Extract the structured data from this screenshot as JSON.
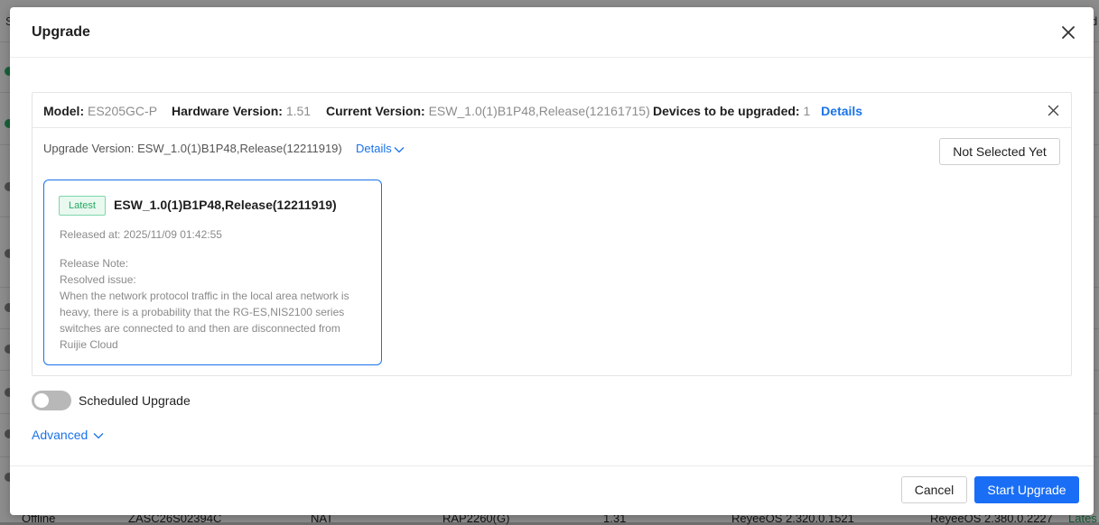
{
  "modal": {
    "title": "Upgrade"
  },
  "info_bar": {
    "model_label": "Model:",
    "model_value": "ES205GC-P",
    "hardware_label": "Hardware Version:",
    "hardware_value": "1.51",
    "current_label": "Current Version:",
    "current_value": "ESW_1.0(1)B1P48,Release(12161715)",
    "devices_label": "Devices to be upgraded:",
    "devices_value": "1",
    "details_link": "Details"
  },
  "upgrade": {
    "version_text": "Upgrade Version: ESW_1.0(1)B1P48,Release(12211919)",
    "details_toggle": "Details",
    "not_selected_button": "Not Selected Yet"
  },
  "version_card": {
    "badge": "Latest",
    "name": "ESW_1.0(1)B1P48,Release(12211919)",
    "released_at": "Released at: 2025/11/09 01:42:55",
    "note_lines": [
      "Release Note:",
      "Resolved issue:",
      "When the network protocol traffic in the local area network is",
      "heavy, there is a probability that the RG-ES,NIS2100 series",
      "switches are connected to and then are disconnected from",
      "Ruijie Cloud"
    ]
  },
  "scheduled": {
    "label": "Scheduled Upgrade",
    "enabled": false
  },
  "advanced": {
    "label": "Advanced"
  },
  "footer": {
    "cancel": "Cancel",
    "start": "Start Upgrade"
  },
  "background": {
    "bottom_row": [
      "Offline",
      "ZASC26S02394C",
      "NAT",
      "RAP2260(G)",
      "1.31",
      "ReyeeOS 2.320.0.1521",
      "ReyeeOS 2.380.0.2227",
      "Lates"
    ],
    "edge_left_top": "S",
    "edge_right_top": "d"
  },
  "colors": {
    "primary": "#1a6ef5",
    "link": "#1a73e8",
    "latest_green": "#27a863"
  }
}
